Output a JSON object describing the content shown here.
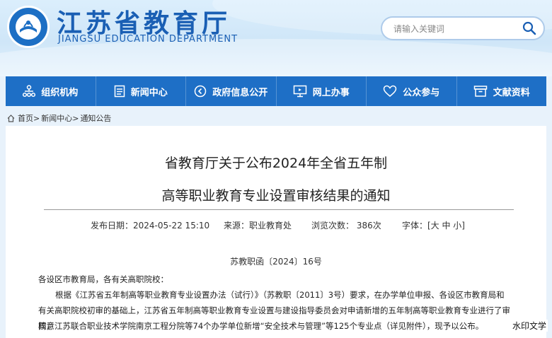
{
  "header": {
    "title": "江苏省教育厅",
    "subtitle": "JIANGSU EDUCATION DEPARTMENT",
    "search_placeholder": "请输入关键词"
  },
  "nav": {
    "items": [
      {
        "label": "组织机构",
        "icon": "org-chart-icon"
      },
      {
        "label": "新闻中心",
        "icon": "news-doc-icon"
      },
      {
        "label": "政府信息公开",
        "icon": "info-disclosure-icon"
      },
      {
        "label": "网上办事",
        "icon": "monitor-icon"
      },
      {
        "label": "公众参与",
        "icon": "heart-icon"
      },
      {
        "label": "文献资料",
        "icon": "archive-icon"
      }
    ]
  },
  "breadcrumb": {
    "items": [
      "首页",
      "新闻中心",
      "通知公告"
    ],
    "separator": ">"
  },
  "article": {
    "title_line1": "省教育厅关于公布2024年全省五年制",
    "title_line2": "高等职业教育专业设置审核结果的通知",
    "publish_date": "发布日期：2024-05-22 15:10",
    "source": "来源：职业教育处",
    "views": "浏览次数： 386次",
    "font_size": "字体：[大 中 小]",
    "doc_number": "苏教职函〔2024〕16号",
    "salutation": "各设区市教育局，各有关高职院校：",
    "body_line1": "根据《江苏省五年制高等职业教育专业设置办法（试行）》（苏教职〔2011〕3号）要求，在办学单位申报、各设区市教育局和",
    "body_line2": "有关高职院校初审的基础上，江苏省五年制高等职业教育专业设置与建设指导委员会对申请新增的五年制高等职业教育专业进行了审核，",
    "body_line3": "同意江苏联合职业技术学院南京工程分院等74个办学单位新增“安全技术与管理”等125个专业点（详见附件），现予以公布。"
  },
  "watermark": "水印文学",
  "colors": {
    "nav_bg": "#1e6fc6",
    "brand_blue": "#1a5fb4",
    "header_bg": "#d4e9f9"
  }
}
